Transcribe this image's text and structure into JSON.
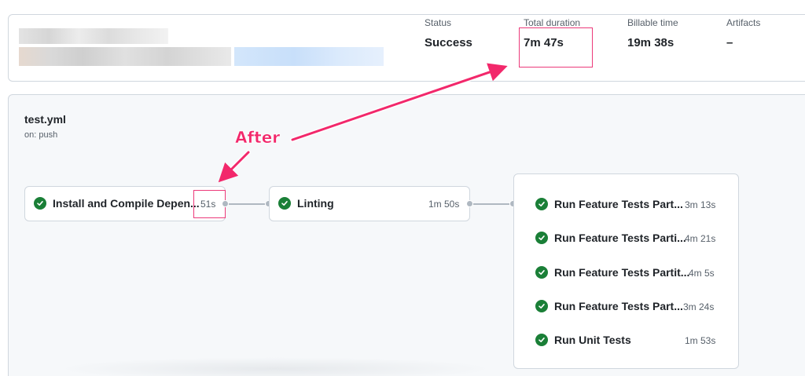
{
  "summary": {
    "status_label": "Status",
    "status_value": "Success",
    "duration_label": "Total duration",
    "duration_value": "7m 47s",
    "billable_label": "Billable time",
    "billable_value": "19m 38s",
    "artifacts_label": "Artifacts",
    "artifacts_value": "–"
  },
  "workflow": {
    "file_name": "test.yml",
    "trigger": "on: push"
  },
  "jobs": [
    {
      "name": "Install and Compile Depen...",
      "time": "51s"
    },
    {
      "name": "Linting",
      "time": "1m 50s"
    }
  ],
  "matrix_jobs": [
    {
      "name": "Run Feature Tests Part...",
      "time": "3m 13s"
    },
    {
      "name": "Run Feature Tests Parti...",
      "time": "4m 21s"
    },
    {
      "name": "Run Feature Tests Partit...",
      "time": "4m 5s"
    },
    {
      "name": "Run Feature Tests Part...",
      "time": "3m 24s"
    },
    {
      "name": "Run Unit Tests",
      "time": "1m 53s"
    }
  ],
  "annotation": {
    "label": "After"
  },
  "colors": {
    "success": "#1a7f37",
    "annotation": "#f2286b",
    "connector": "#afb8c1"
  },
  "icons": {
    "job_status": "check-circle-icon"
  }
}
